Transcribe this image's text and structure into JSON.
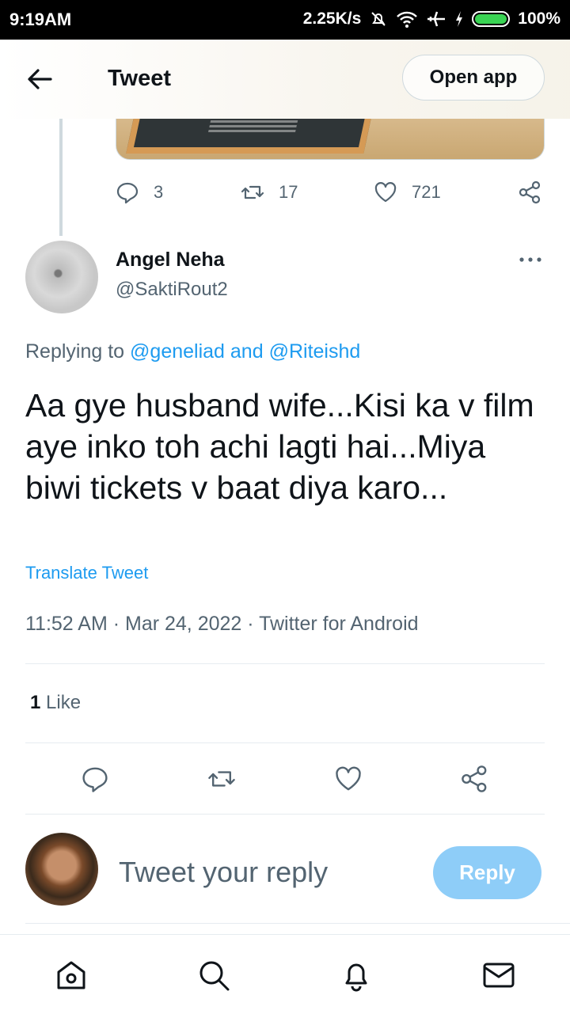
{
  "status_bar": {
    "time": "9:19AM",
    "speed": "2.25K/s",
    "battery": "100%"
  },
  "header": {
    "title": "Tweet",
    "open_app_label": "Open app"
  },
  "parent_tweet": {
    "reply_count": "3",
    "retweet_count": "17",
    "like_count": "721"
  },
  "tweet": {
    "author_name": "Angel Neha",
    "author_handle": "@SaktiRout2",
    "replying_prefix": "Replying to",
    "replying_to_1": "@geneliad",
    "replying_and": "and",
    "replying_to_2": "@Riteishd",
    "text": "Aa gye husband wife...Kisi ka v film aye inko toh achi lagti hai...Miya biwi tickets v baat diya karo...",
    "translate_label": "Translate Tweet",
    "meta": "11:52 AM · Mar 24, 2022 · Twitter for Android",
    "likes_count": "1",
    "likes_label": "Like"
  },
  "composer": {
    "placeholder": "Tweet your reply",
    "reply_button": "Reply"
  },
  "icons": {
    "back": "arrow-left-icon",
    "more": "more-dots-icon",
    "reply": "reply-icon",
    "retweet": "retweet-icon",
    "like": "heart-icon",
    "share": "share-icon",
    "home": "home-icon",
    "search": "search-icon",
    "notifications": "bell-icon",
    "messages": "mail-icon"
  },
  "colors": {
    "link": "#1d9bf0",
    "reply_button": "#8ecdf8",
    "muted_text": "#536471"
  }
}
